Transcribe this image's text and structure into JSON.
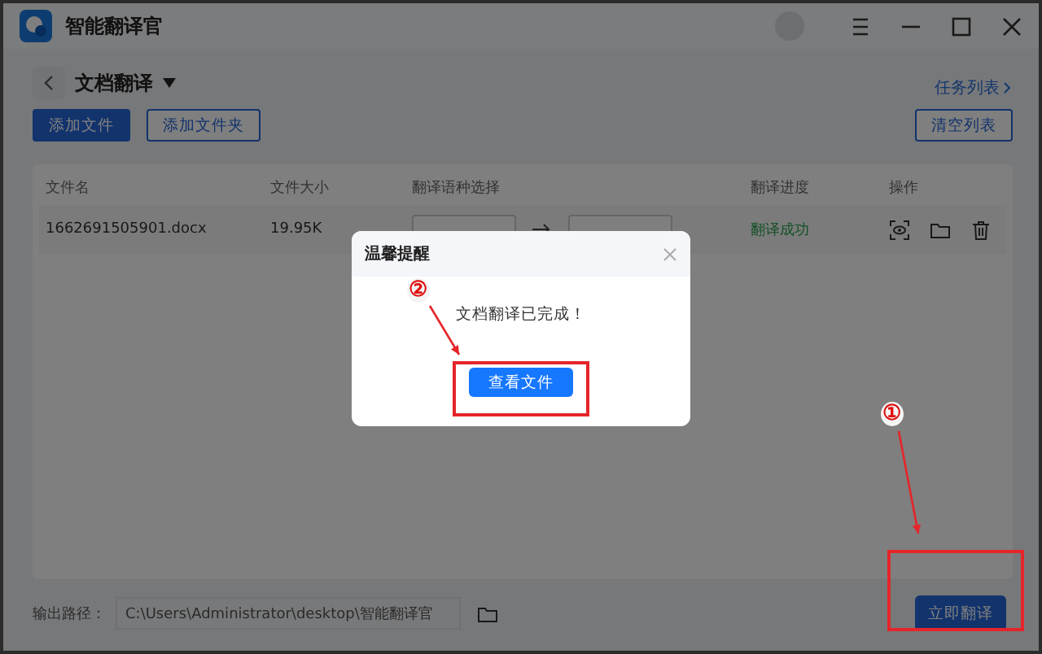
{
  "window": {
    "title": "智能翻译官"
  },
  "page": {
    "title": "文档翻译",
    "task_list_link": "任务列表"
  },
  "toolbar": {
    "buttons": [
      {
        "label": "添加文件",
        "kind": "primary"
      },
      {
        "label": "添加文件夹",
        "kind": "outline"
      }
    ],
    "clear_button": "清空列表"
  },
  "table": {
    "columns": [
      "文件名",
      "文件大小",
      "翻译语种选择",
      "翻译进度",
      "操作"
    ],
    "rows": [
      {
        "file_name": "1662691505901.docx",
        "size": "19.95K",
        "status": "翻译成功"
      }
    ]
  },
  "output": {
    "label": "输出路径：",
    "path": "C:\\Users\\Administrator\\desktop\\智能翻译官"
  },
  "translate_button": "立即翻译",
  "dialog": {
    "title": "温馨提醒",
    "message": "文档翻译已完成！",
    "button": "查看文件"
  },
  "annotations": [
    {
      "label": "①"
    },
    {
      "label": "②"
    }
  ]
}
